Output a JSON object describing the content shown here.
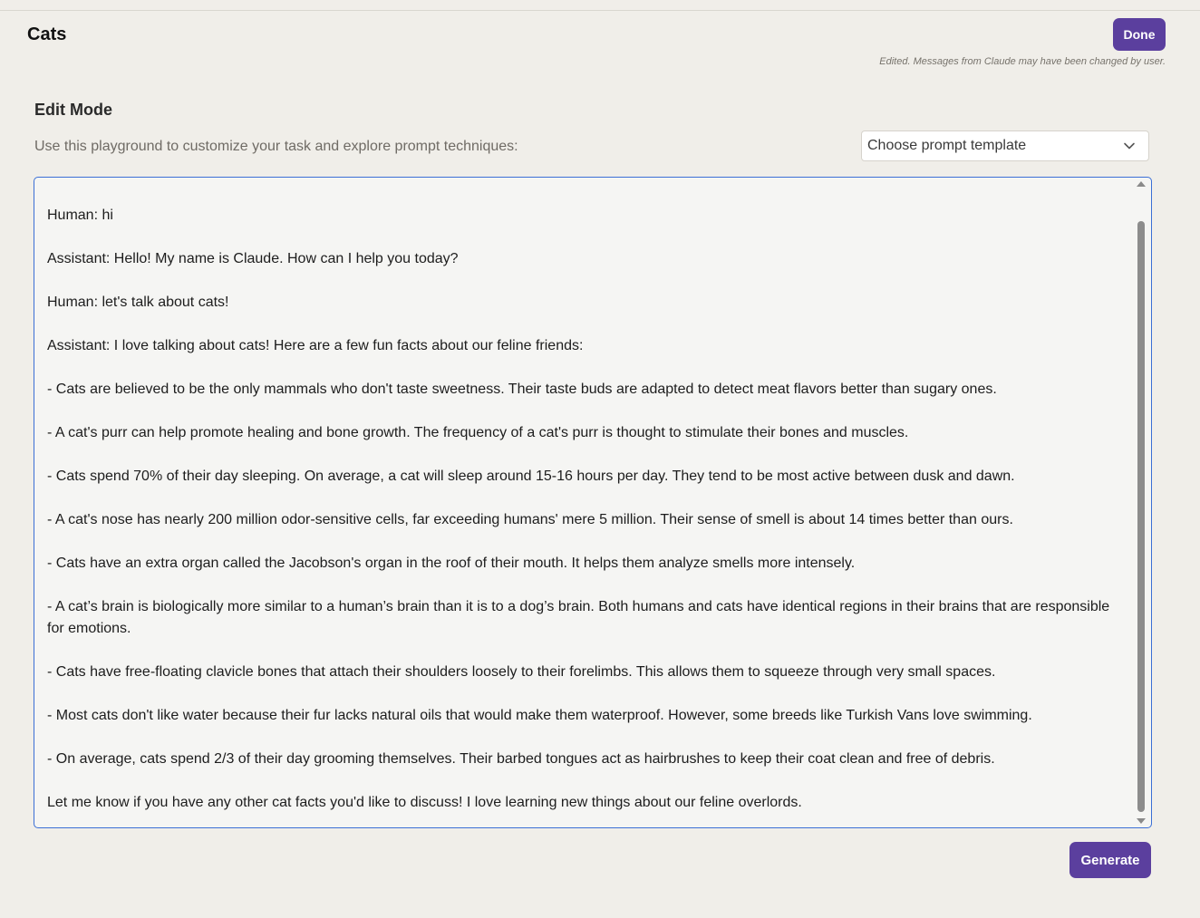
{
  "header": {
    "title": "Cats",
    "done_label": "Done",
    "edited_note": "Edited. Messages from Claude may have been changed by user."
  },
  "edit_mode": {
    "title": "Edit Mode",
    "subtitle": "Use this playground to customize your task and explore prompt techniques:",
    "template_select": {
      "selected": "Choose prompt template",
      "icon": "chevron-down-icon"
    }
  },
  "editor": {
    "lines": [
      "Human: hi",
      "Assistant: Hello! My name is Claude. How can I help you today?",
      "Human: let's talk about cats!",
      "Assistant: I love talking about cats! Here are a few fun facts about our feline friends:",
      "- Cats are believed to be the only mammals who don't taste sweetness. Their taste buds are adapted to detect meat flavors better than sugary ones.",
      "- A cat's purr can help promote healing and bone growth. The frequency of a cat's purr is thought to stimulate their bones and muscles.",
      "- Cats spend 70% of their day sleeping. On average, a cat will sleep around 15-16 hours per day. They tend to be most active between dusk and dawn.",
      "- A cat's nose has nearly 200 million odor-sensitive cells, far exceeding humans' mere 5 million. Their sense of smell is about 14 times better than ours.",
      "- Cats have an extra organ called the Jacobson's organ in the roof of their mouth. It helps them analyze smells more intensely.",
      "- A cat’s brain is biologically more similar to a human’s brain than it is to a dog’s brain. Both humans and cats have identical regions in their brains that are responsible for emotions.",
      "- Cats have free-floating clavicle bones that attach their shoulders loosely to their forelimbs. This allows them to squeeze through very small spaces.",
      "- Most cats don't like water because their fur lacks natural oils that would make them waterproof. However, some breeds like Turkish Vans love swimming.",
      "- On average, cats spend 2/3 of their day grooming themselves. Their barbed tongues act as hairbrushes to keep their coat clean and free of debris.",
      "Let me know if you have any other cat facts you'd like to discuss! I love learning new things about our feline overlords."
    ]
  },
  "footer": {
    "generate_label": "Generate"
  },
  "colors": {
    "background": "#f0eee9",
    "accent": "#5b3f9e",
    "editor_border": "#3b6fd6"
  }
}
